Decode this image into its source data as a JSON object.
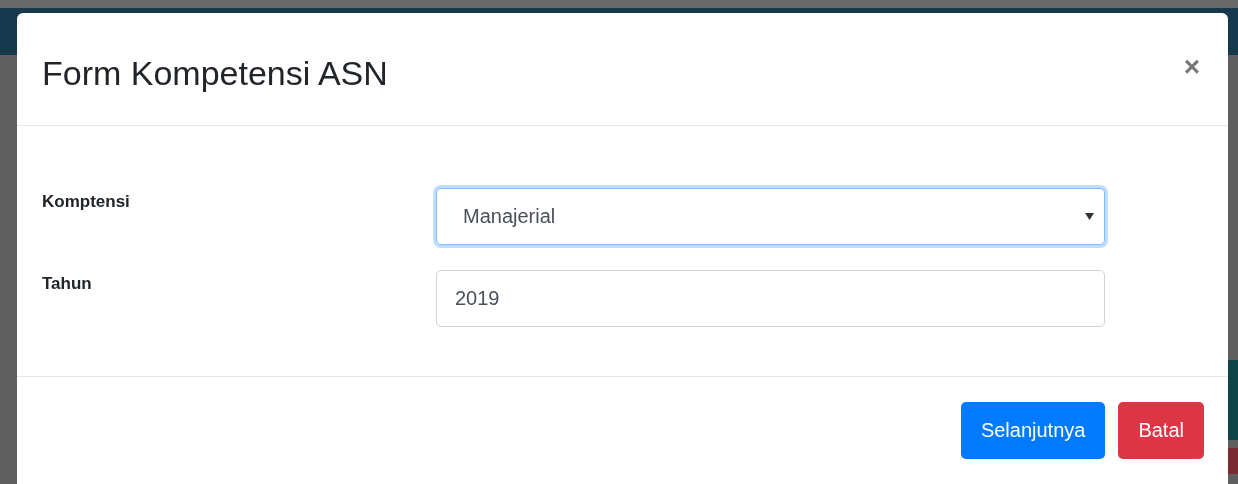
{
  "modal": {
    "title": "Form Kompetensi ASN",
    "close": "×"
  },
  "fields": [
    {
      "kind": "select",
      "label": "Komptensi",
      "value": "Manajerial",
      "focused": true
    },
    {
      "kind": "text",
      "label": "Tahun",
      "value": "2019",
      "focused": false
    }
  ],
  "buttons": [
    {
      "label": "Selanjutnya",
      "kind": "primary"
    },
    {
      "label": "Batal",
      "kind": "danger"
    }
  ]
}
